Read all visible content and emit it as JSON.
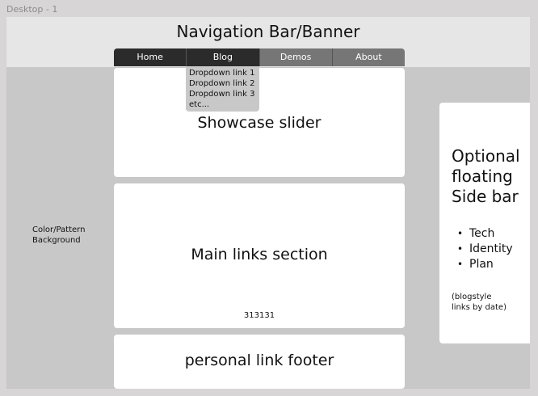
{
  "frame_label": "Desktop - 1",
  "banner": {
    "title": "Navigation Bar/Banner"
  },
  "nav": {
    "items": [
      {
        "label": "Home"
      },
      {
        "label": "Blog"
      },
      {
        "label": "Demos"
      },
      {
        "label": "About"
      }
    ]
  },
  "dropdown": {
    "items": [
      {
        "label": "Dropdown link 1"
      },
      {
        "label": "Dropdown link 2"
      },
      {
        "label": "Dropdown link 3"
      },
      {
        "label": "etc..."
      }
    ]
  },
  "showcase": {
    "title": "Showcase slider"
  },
  "main_links": {
    "title": "Main links section",
    "number": "313131"
  },
  "footer": {
    "title": "personal link footer"
  },
  "background_label": {
    "line1": "Color/Pattern",
    "line2": "Background"
  },
  "sidebar": {
    "title_lines": [
      "Optional",
      "floating",
      "Side bar"
    ],
    "items": [
      "Tech",
      "Identity",
      "Plan"
    ],
    "note_lines": [
      "(blogstyle",
      "links by date)"
    ]
  },
  "colors": {
    "page_background": "#d7d5d6",
    "frame_background": "#c8c8c8",
    "banner_background": "#e6e6e6",
    "nav_dark": "#2b2b2b",
    "nav_light": "#767676",
    "panel": "#ffffff"
  }
}
